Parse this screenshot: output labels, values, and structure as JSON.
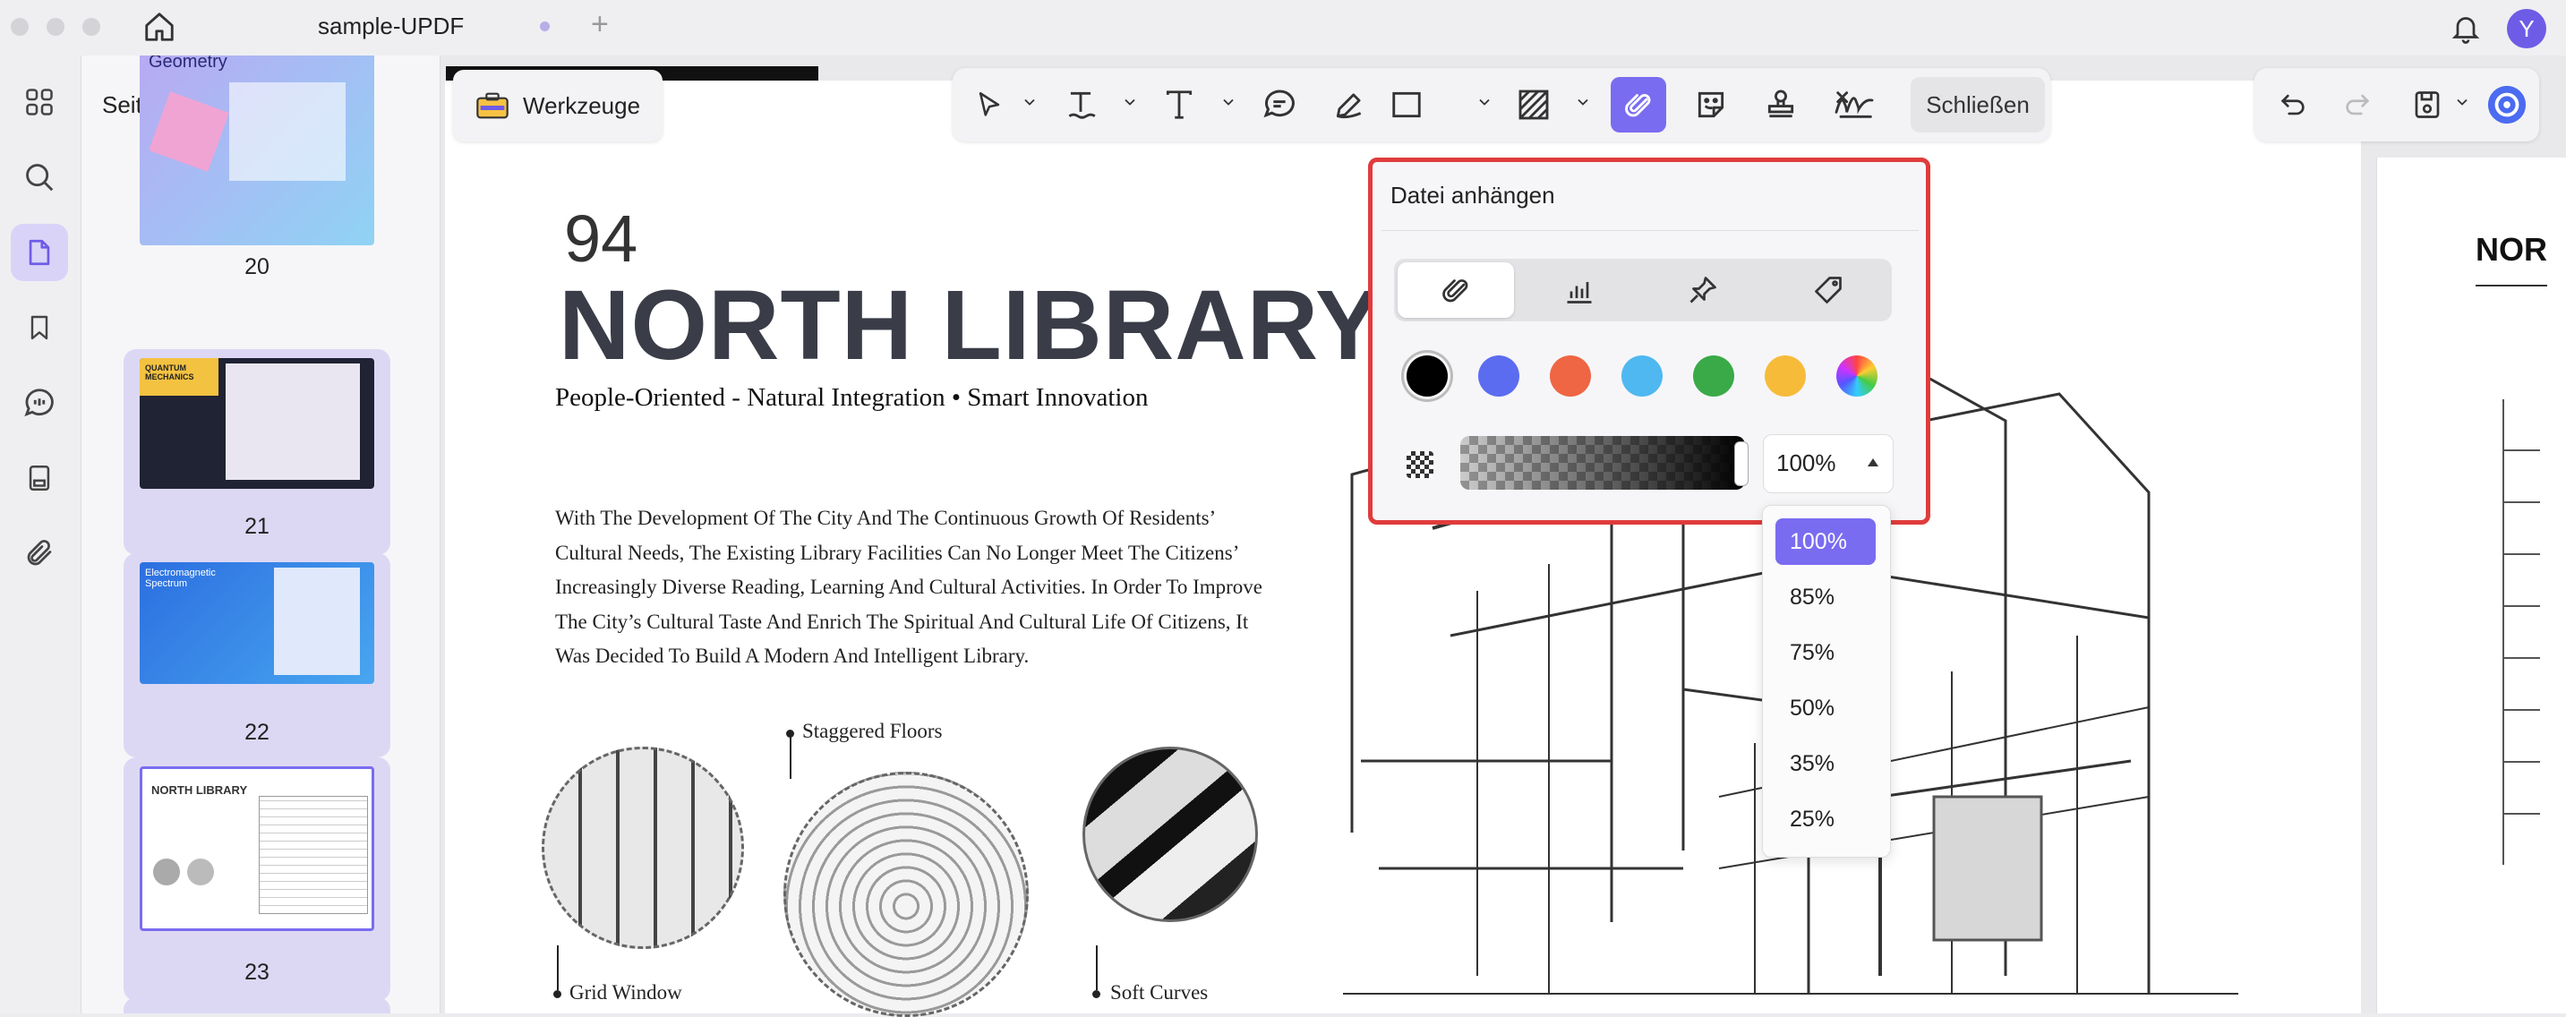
{
  "window": {
    "tab_title": "sample-UPDF",
    "avatar_initial": "Y"
  },
  "rail": {
    "items": [
      "thumbnails-grid",
      "search",
      "pages",
      "bookmarks",
      "comments",
      "form",
      "attachments"
    ]
  },
  "thumbnails": {
    "title": "Seitenminiaturen",
    "pages": [
      {
        "number": "20",
        "title": "Geometry"
      },
      {
        "number": "21",
        "title": "QUANTUM MECHANICS"
      },
      {
        "number": "22",
        "title": "Electromagnetic Spectrum"
      },
      {
        "number": "23",
        "title": "NORTH LIBRARY"
      }
    ]
  },
  "toolbar": {
    "tools_label": "Werkzeuge",
    "close_label": "Schließen"
  },
  "popup": {
    "title": "Datei anhängen",
    "types": [
      "paperclip",
      "graph",
      "pushpin",
      "tag"
    ],
    "colors": [
      "#000000",
      "#5b6cf0",
      "#ee6644",
      "#4fb8f0",
      "#3aaa48",
      "#f7bb3a",
      "rainbow"
    ],
    "opacity_value": "100%"
  },
  "opacity_options": [
    "100%",
    "85%",
    "75%",
    "50%",
    "35%",
    "25%"
  ],
  "page": {
    "number": "94",
    "title": "NORTH LIBRARY",
    "subtitle": "People-Oriented - Natural Integration • Smart Innovation",
    "body_lines": [
      "With The Development Of The City And The Continuous Growth Of Residents’",
      "Cultural Needs, The Existing Library Facilities Can No Longer Meet The Citizens’",
      "Increasingly Diverse Reading, Learning And Cultural Activities. In Order To Improve",
      "The City’s Cultural Taste And Enrich The Spiritual And Cultural Life Of Citizens, It",
      "Was Decided To Build A Modern And Intelligent Library."
    ],
    "captions": {
      "staggered": "Staggered Floors",
      "grid": "Grid Window",
      "soft": "Soft Curves"
    },
    "next_page_title": "NOR"
  }
}
